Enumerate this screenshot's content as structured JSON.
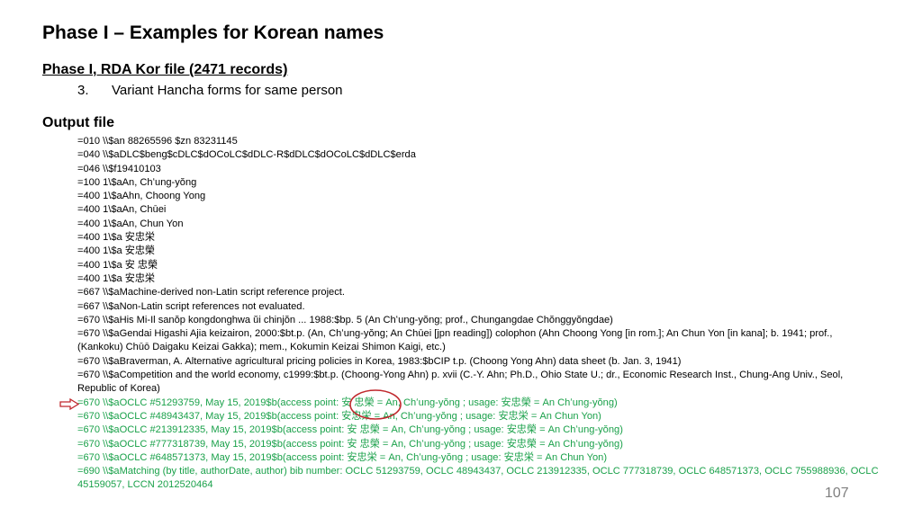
{
  "title": "Phase I – Examples for Korean names",
  "section": "Phase I,  RDA Kor file (2471 records)",
  "list_item": {
    "number": "3.",
    "text": "Variant Hancha forms for same person"
  },
  "output_heading": "Output file",
  "lines": [
    "=010  \\\\$an  88265596 $zn  83231145",
    "=040  \\\\$aDLC$beng$cDLC$dOCoLC$dDLC-R$dDLC$dOCoLC$dDLC$erda",
    "=046  \\\\$f19410103",
    "=100  1\\$aAn, Chʻung-yŏng",
    "=400  1\\$aAhn, Choong Yong",
    "=400  1\\$aAn, Chūei",
    "=400  1\\$aAn, Chun Yon",
    "=400  1\\$a 安忠栄",
    "=400  1\\$a 安忠榮",
    "=400  1\\$a 安 忠榮",
    "=400  1\\$a 安忠栄",
    "=667  \\\\$aMachine-derived non-Latin script reference project.",
    "=667  \\\\$aNon-Latin script references not evaluated.",
    "=670  \\\\$aHis Mi-Il sanŏp kongdonghwa ŭi chinjŏn ... 1988:$bp. 5 (An Chʻung-yŏng; prof., Chungangdae Chŏnggyŏngdae)",
    "=670  \\\\$aGendai Higashi Ajia keizairon, 2000:$bt.p. (An, Chʻung-yŏng; An Chūei [jpn reading]) colophon (Ahn Choong Yong [in rom.]; An Chun Yon [in kana]; b. 1941; prof., (Kankoku) Chūō Daigaku Keizai Gakka); mem., Kokumin Keizai Shimon Kaigi, etc.)",
    "=670  \\\\$aBraverman, A. Alternative agricultural pricing policies in Korea, 1983:$bCIP t.p. (Choong Yong Ahn) data sheet (b. Jan. 3, 1941)",
    "=670  \\\\$aCompetition and the world economy, c1999:$bt.p. (Choong-Yong Ahn) p. xvii (C.-Y. Ahn; Ph.D., Ohio State U.; dr., Economic Research Inst., Chung-Ang Univ., Seol, Republic of Korea)"
  ],
  "green_lines": [
    "=670  \\\\$aOCLC #51293759, May 15, 2019$b(access point:  安 忠榮  = An, Chʻung-yŏng ; usage:  安忠榮  = An Chʻung-yŏng)",
    "=670  \\\\$aOCLC #48943437, May 15, 2019$b(access point:  安忠栄  = An, Chʻung-yŏng ; usage:  安忠栄  = An Chun Yon)",
    "=670  \\\\$aOCLC #213912335, May 15, 2019$b(access point:  安 忠榮  = An, Chʻung-yŏng ; usage:  安忠榮  = An Chʻung-yŏng)",
    "=670  \\\\$aOCLC #777318739, May 15, 2019$b(access point:  安 忠榮  = An, Chʻung-yŏng ; usage:  安忠榮  = An Chʻung-yŏng)",
    "=670  \\\\$aOCLC #648571373, May 15, 2019$b(access point:  安忠栄  = An, Chʻung-yŏng ; usage:  安忠栄  = An Chun Yon)",
    "=690  \\\\$aMatching (by title, authorDate, author) bib number: OCLC 51293759, OCLC 48943437, OCLC 213912335, OCLC 777318739, OCLC 648571373, OCLC 755988936, OCLC 45159057, LCCN   2012520464"
  ],
  "page_number": "107",
  "colors": {
    "green": "#1aa14a",
    "annotation_red": "#c0282d",
    "page_number": "#7f7f7f"
  },
  "annotations": [
    "pointer-arrow",
    "highlight-circle"
  ]
}
